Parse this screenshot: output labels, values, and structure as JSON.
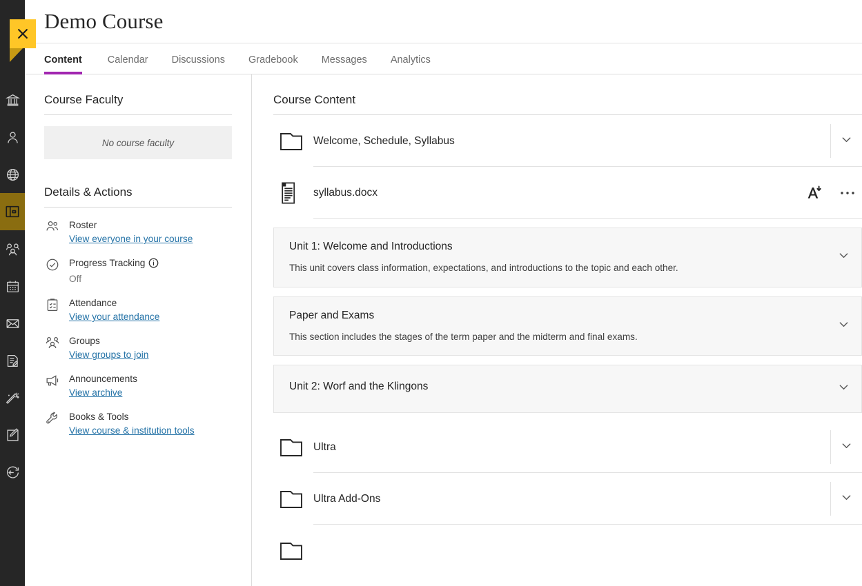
{
  "header": {
    "course_title": "Demo Course",
    "close_label": "Close course"
  },
  "tabs": [
    {
      "label": "Content",
      "active": true
    },
    {
      "label": "Calendar",
      "active": false
    },
    {
      "label": "Discussions",
      "active": false
    },
    {
      "label": "Gradebook",
      "active": false
    },
    {
      "label": "Messages",
      "active": false
    },
    {
      "label": "Analytics",
      "active": false
    }
  ],
  "rail": {
    "items": [
      {
        "icon": "institution-icon",
        "active": false
      },
      {
        "icon": "profile-icon",
        "active": false
      },
      {
        "icon": "globe-icon",
        "active": false
      },
      {
        "icon": "courses-icon",
        "active": true
      },
      {
        "icon": "groups-icon",
        "active": false
      },
      {
        "icon": "calendar-icon",
        "active": false
      },
      {
        "icon": "messages-icon",
        "active": false
      },
      {
        "icon": "grades-icon",
        "active": false
      },
      {
        "icon": "tools-icon",
        "active": false
      },
      {
        "icon": "support-icon",
        "active": false
      },
      {
        "icon": "signout-icon",
        "active": false
      }
    ]
  },
  "sidebar": {
    "faculty": {
      "title": "Course Faculty",
      "empty_text": "No course faculty"
    },
    "details": {
      "title": "Details & Actions",
      "items": [
        {
          "icon": "roster-icon",
          "label": "Roster",
          "link": "View everyone in your course",
          "is_link": true,
          "has_info": false
        },
        {
          "icon": "progress-check-icon",
          "label": "Progress Tracking",
          "link": "Off",
          "is_link": false,
          "has_info": true
        },
        {
          "icon": "attendance-icon",
          "label": "Attendance",
          "link": "View your attendance",
          "is_link": true,
          "has_info": false
        },
        {
          "icon": "groups-icon",
          "label": "Groups",
          "link": "View groups to join",
          "is_link": true,
          "has_info": false
        },
        {
          "icon": "announcements-icon",
          "label": "Announcements",
          "link": "View archive",
          "is_link": true,
          "has_info": false
        },
        {
          "icon": "wrench-icon",
          "label": "Books & Tools",
          "link": "View course & institution tools",
          "is_link": true,
          "has_info": false
        }
      ]
    }
  },
  "content": {
    "title": "Course Content",
    "items": [
      {
        "kind": "folder",
        "icon": "folder-icon",
        "label": "Welcome, Schedule, Syllabus",
        "has_chevron": true,
        "has_ally": false,
        "has_overflow": false
      },
      {
        "kind": "file",
        "icon": "document-icon",
        "label": "syllabus.docx",
        "has_chevron": false,
        "has_ally": true,
        "has_overflow": true
      },
      {
        "kind": "unit",
        "label": "Unit 1: Welcome and Introductions",
        "description": "This unit covers class information, expectations, and introductions to the topic and each other.",
        "has_chevron": true
      },
      {
        "kind": "unit",
        "label": "Paper and Exams",
        "description": "This section includes the stages of the term paper and the midterm and final exams.",
        "has_chevron": true
      },
      {
        "kind": "unit",
        "label": "Unit 2: Worf and the Klingons",
        "description": "",
        "has_chevron": true
      },
      {
        "kind": "folder",
        "icon": "folder-icon",
        "label": "Ultra",
        "has_chevron": true,
        "has_ally": false,
        "has_overflow": false
      },
      {
        "kind": "folder",
        "icon": "folder-icon",
        "label": "Ultra Add-Ons",
        "has_chevron": true,
        "has_ally": false,
        "has_overflow": false
      }
    ],
    "ally_label": "Alternative formats",
    "overflow_label": "More options"
  },
  "colors": {
    "rail_bg": "#262626",
    "rail_active": "#8a6d10",
    "accent_purple": "#a226b0",
    "ribbon_yellow": "#ffc627",
    "link_blue": "#2573a7",
    "panel_bg": "#f7f7f7"
  }
}
